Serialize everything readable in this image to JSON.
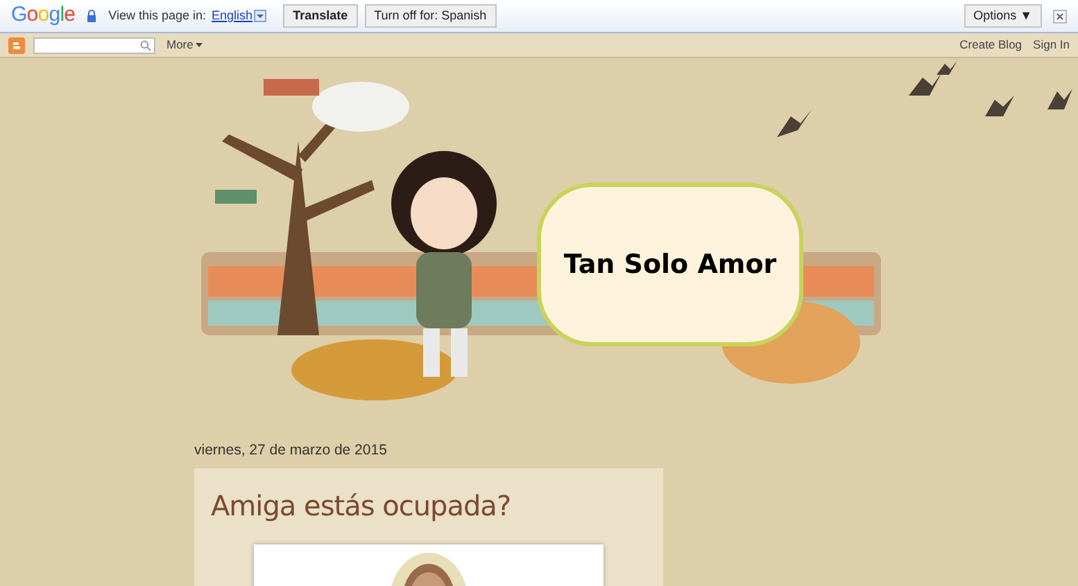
{
  "translate_bar": {
    "logo": "Google",
    "prompt": "View this page in:",
    "language": "English",
    "buttons": [
      "Translate",
      "Turn off for: Spanish"
    ],
    "options": "Options ▼"
  },
  "navbar": {
    "more": "More",
    "links": [
      "Create Blog",
      "Sign In"
    ]
  },
  "header": {
    "kind": "picture",
    "title": "Tan Solo Amor"
  },
  "post": {
    "date": "viernes, 27 de marzo de 2015",
    "title": "Amiga estás ocupada?"
  }
}
